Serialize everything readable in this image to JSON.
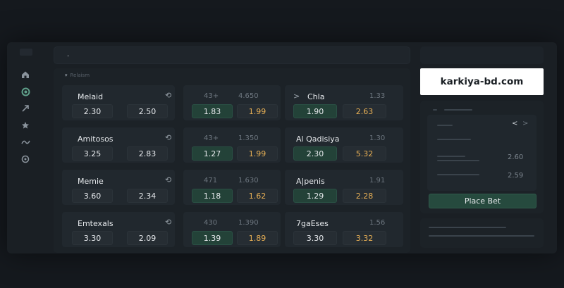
{
  "search": {
    "text": "."
  },
  "section": {
    "label": "Relaism"
  },
  "brand": {
    "name": "karkiya-bd.com"
  },
  "betslip": {
    "nav_prev": "<",
    "nav_next": ">",
    "odd_1": "2.60",
    "odd_2": "2.59",
    "place_bet_label": "Place Bet"
  },
  "sidebar": {
    "icons": [
      "home-icon",
      "live-icon",
      "trending-icon",
      "star-icon",
      "stats-icon",
      "settings-icon"
    ]
  },
  "matches": [
    {
      "home": {
        "team": "Melaid",
        "odds": [
          "2.30",
          "2.50"
        ]
      },
      "mid": {
        "line": "43+",
        "value": "4.650",
        "odds": [
          "1.83",
          "1.99"
        ]
      },
      "away": {
        "team": "Chla",
        "value": "1.33",
        "odds": [
          "1.90",
          "2.63"
        ]
      }
    },
    {
      "home": {
        "team": "Amitosos",
        "odds": [
          "3.25",
          "2.83"
        ]
      },
      "mid": {
        "line": "43+",
        "value": "1.350",
        "odds": [
          "1.27",
          "1.99"
        ]
      },
      "away": {
        "team": "Al Qadisiya",
        "value": "1.30",
        "odds": [
          "2.30",
          "5.32"
        ]
      }
    },
    {
      "home": {
        "team": "Memie",
        "odds": [
          "3.60",
          "2.34"
        ]
      },
      "mid": {
        "line": "471",
        "value": "1.630",
        "odds": [
          "1.18",
          "1.62"
        ]
      },
      "away": {
        "team": "A|penis",
        "value": "1.91",
        "odds": [
          "1.29",
          "2.28"
        ]
      }
    },
    {
      "home": {
        "team": "Emtexals",
        "odds": [
          "3.30",
          "2.09"
        ]
      },
      "mid": {
        "line": "430",
        "value": "1.390",
        "odds": [
          "1.39",
          "1.89"
        ]
      },
      "away": {
        "team": "7gaEses",
        "value": "1.56",
        "odds": [
          "3.30",
          "3.32"
        ]
      }
    }
  ],
  "colors": {
    "background": "#15191e",
    "panel": "#1c2227",
    "odd_green": "#234238",
    "odd_orange_text": "#e8b055",
    "brand_bg": "#ffffff"
  }
}
